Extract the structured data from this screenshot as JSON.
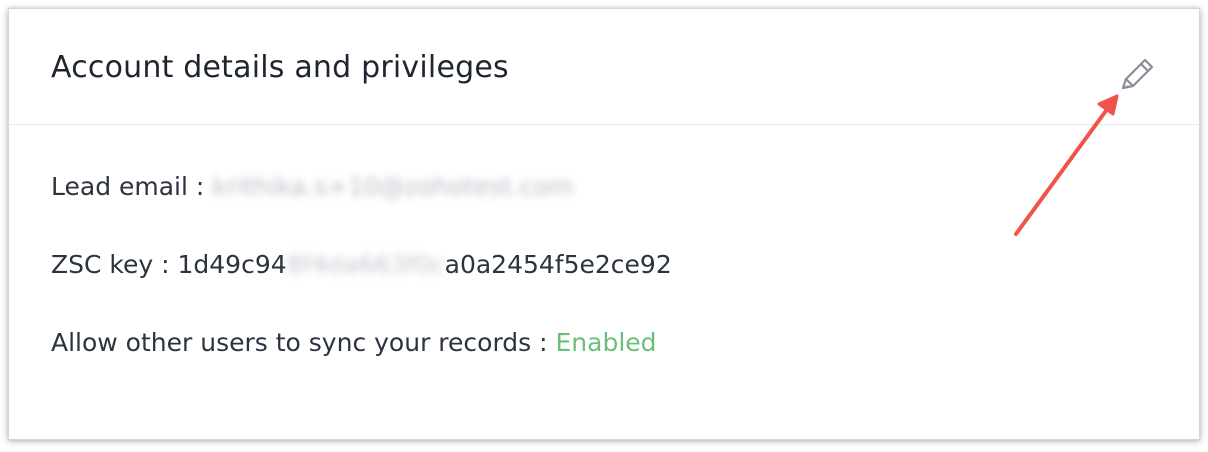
{
  "card": {
    "title": "Account details and privileges",
    "edit_icon": "pencil-icon"
  },
  "details": {
    "lead_email_label": "Lead email :",
    "lead_email_value": "krithika.s+10@zohotest.com",
    "zsc_key_label": "ZSC key :",
    "zsc_key_prefix": "1d49c94",
    "zsc_key_hidden": "8f4da663f0c",
    "zsc_key_suffix": "a0a2454f5e2ce92",
    "sync_label": "Allow other users to sync your records :",
    "sync_status": "Enabled"
  },
  "colors": {
    "status_enabled": "#6cbf7b",
    "annotation_arrow": "#f0534a"
  },
  "annotation": {
    "icon": "arrow-annotation-icon"
  }
}
